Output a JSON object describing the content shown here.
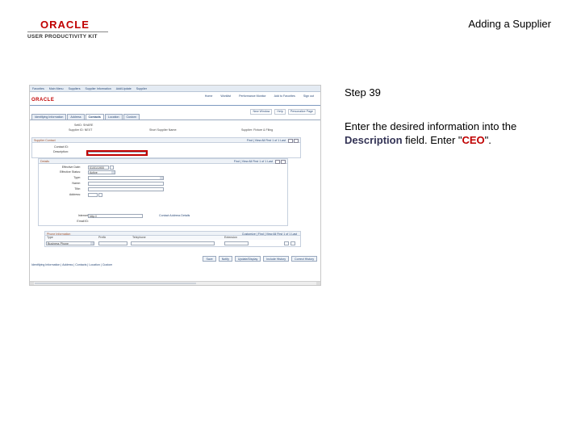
{
  "header": {
    "logo_brand": "ORACLE",
    "logo_product": "USER PRODUCTIVITY KIT",
    "slide_title": "Adding a Supplier"
  },
  "step": {
    "number": "Step 39",
    "text_before": "Enter the desired information into the ",
    "field_name": "Description",
    "text_middle": " field. Enter \"",
    "value": "CEO",
    "text_after": "\"."
  },
  "app": {
    "nav": [
      "Favorites",
      "Main Menu",
      "Suppliers",
      "Supplier Information",
      "Add/Update",
      "Supplier"
    ],
    "top_links": [
      "Home",
      "Worklist",
      "Performance Monitor",
      "Add to Favorites",
      "Sign out"
    ],
    "brand": "ORACLE",
    "page_links": [
      "New Window",
      "Help",
      "Personalize Page"
    ],
    "tabs": [
      "Identifying Information",
      "Address",
      "Contacts",
      "Location",
      "Custom"
    ],
    "summary": {
      "setid": "SetID: SHARE",
      "supplier_id": "Supplier ID: NEXT",
      "short_name": "Short Supplier Name:",
      "supplier_name": "Supplier: Fixture & Filing"
    },
    "contact_group": {
      "title": "Supplier Contact",
      "nav": "Find | View All   First  1 of 1  Last",
      "contact_label": "Contact ID:",
      "description_label": "Description:"
    },
    "details": {
      "title": "Details",
      "nav": "Find | View All   First  1 of 1  Last",
      "effective_date_label": "Effective Date:",
      "effective_date_value": "01/01/1900",
      "status_label": "Effective Status:",
      "status_value": "Active",
      "type_label": "Type:",
      "name_label": "Name:",
      "title_label": "Title:",
      "address_label": "Address:",
      "url_label": "Internet:",
      "url_value": "http://",
      "email_label": "Email ID:",
      "contact_address": "Contact Address Details"
    },
    "phone": {
      "title": "Phone Information",
      "nav": "Customize | Find | View All   First  1 of 1  Last",
      "cols": [
        "Type",
        "Prefix",
        "Telephone",
        "Extension"
      ],
      "row_type": "Business Phone"
    },
    "buttons": [
      "Save",
      "Notify",
      "Update/Display",
      "Include History",
      "Correct History"
    ],
    "footer_links": "Identifying Information | Address | Contacts | Location | Custom"
  }
}
